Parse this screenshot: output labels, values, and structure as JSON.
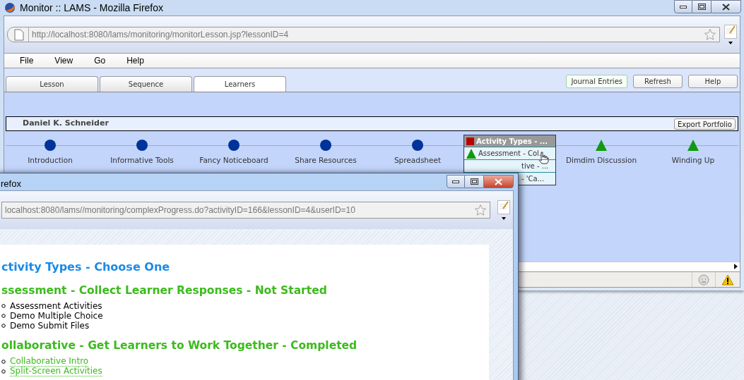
{
  "main_window": {
    "title": "Monitor :: LAMS - Mozilla Firefox",
    "url": "http://localhost:8080/lams/monitoring/monitorLesson.jsp?lessonID=4",
    "menu": [
      "File",
      "View",
      "Go",
      "Help"
    ],
    "tabs": [
      {
        "label": "Lesson",
        "selected": false
      },
      {
        "label": "Sequence",
        "selected": false
      },
      {
        "label": "Learners",
        "selected": true
      }
    ],
    "buttons": [
      {
        "label": "Journal Entries",
        "highlighted": true
      },
      {
        "label": "Refresh",
        "highlighted": false
      },
      {
        "label": "Help",
        "highlighted": false
      }
    ],
    "learner": {
      "name": "Daniel K. Schneider",
      "button": "Export Portfolio"
    },
    "activities": [
      {
        "kind": "circle",
        "label": "Introduction"
      },
      {
        "kind": "circle",
        "label": "Informative Tools"
      },
      {
        "kind": "circle",
        "label": "Fancy Noticeboard"
      },
      {
        "kind": "circle",
        "label": "Share Resources"
      },
      {
        "kind": "circle",
        "label": "Spreadsheet"
      },
      {
        "kind": "branch",
        "label": "Activity Types - ...",
        "options": [
          {
            "kind": "triangle",
            "label": "Assessment - Col..."
          },
          {
            "kind": "hidden",
            "label": "tive - ..."
          },
          {
            "kind": "hidden",
            "label": "- 'Ca..."
          }
        ]
      },
      {
        "kind": "triangle",
        "label": "Dimdim Discussion"
      },
      {
        "kind": "triangle",
        "label": "Winding Up"
      }
    ]
  },
  "popup_window": {
    "title": "refox",
    "url": "localhost:8080/lams//monitoring/complexProgress.do?activityID=166&lessonID=4&userID=10",
    "heading": "ctivity Types - Choose One",
    "sections": [
      {
        "title": "ssessment - Collect Learner Responses - Not Started",
        "items": [
          {
            "label": "Assessment Activities",
            "link": false
          },
          {
            "label": "Demo Multiple Choice",
            "link": false
          },
          {
            "label": "Demo Submit Files",
            "link": false
          }
        ]
      },
      {
        "title": "ollaborative - Get Learners to Work Together - Completed",
        "items": [
          {
            "label": "Collaborative Intro",
            "link": true
          },
          {
            "label": "Split-Screen Activities",
            "link": true
          }
        ]
      }
    ]
  }
}
